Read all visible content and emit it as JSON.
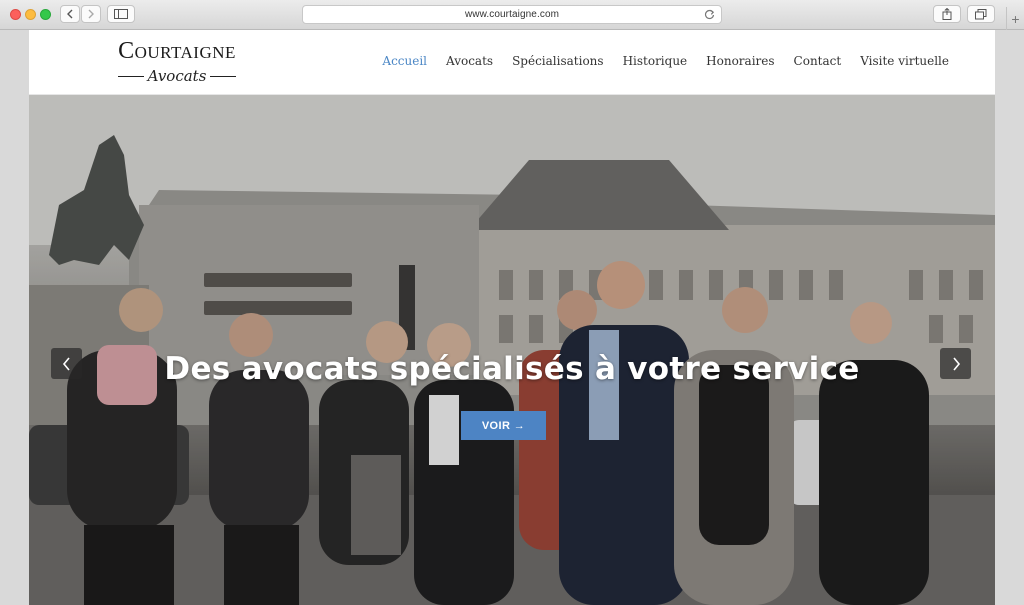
{
  "browser": {
    "url": "www.courtaigne.com"
  },
  "brand": {
    "name": "Courtaigne",
    "subtitle": "Avocats"
  },
  "nav": {
    "items": [
      {
        "label": "Accueil",
        "active": true
      },
      {
        "label": "Avocats",
        "active": false
      },
      {
        "label": "Spécialisations",
        "active": false
      },
      {
        "label": "Historique",
        "active": false
      },
      {
        "label": "Honoraires",
        "active": false
      },
      {
        "label": "Contact",
        "active": false
      },
      {
        "label": "Visite virtuelle",
        "active": false
      }
    ]
  },
  "hero": {
    "title": "Des avocats spécialisés à votre service",
    "button_label": "VOIR →"
  },
  "colors": {
    "accent": "#4a86c5",
    "button": "#4d84c4",
    "text": "#333333"
  },
  "icons": {
    "prev": "chevron-left-icon",
    "next": "chevron-right-icon",
    "reload": "reload-icon",
    "share": "share-icon",
    "tabs": "tabs-icon",
    "sidebar": "sidebar-icon"
  }
}
